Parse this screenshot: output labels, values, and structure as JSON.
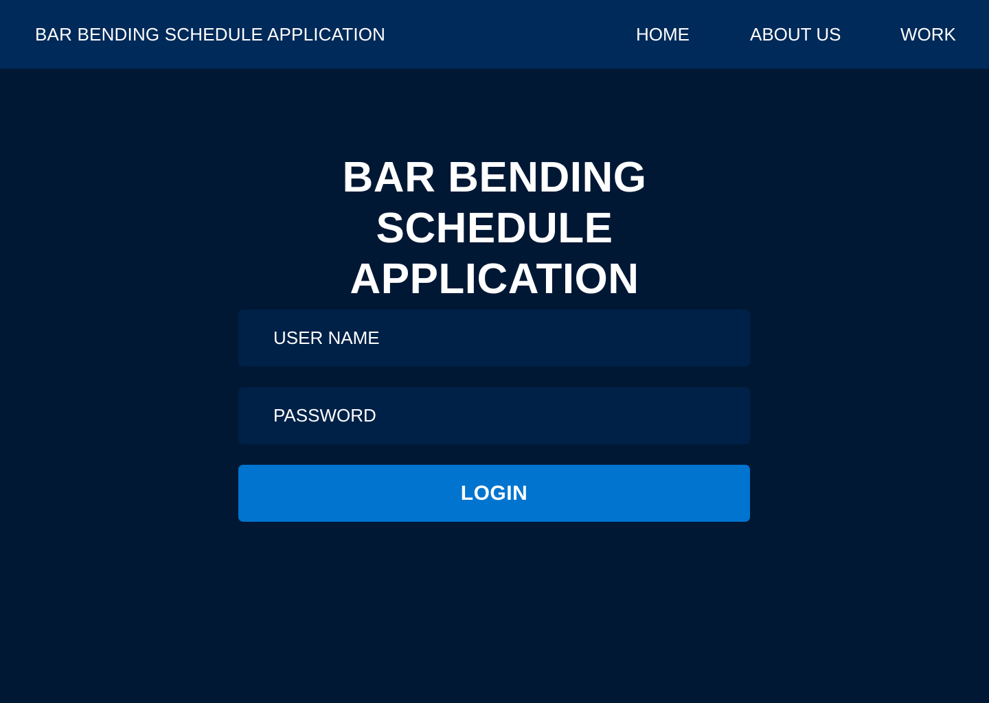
{
  "header": {
    "brand": "BAR BENDING SCHEDULE APPLICATION",
    "nav": {
      "home": "HOME",
      "about": "ABOUT US",
      "work": "WORK"
    }
  },
  "main": {
    "title_line1": "BAR BENDING SCHEDULE",
    "title_line2": "APPLICATION",
    "username": {
      "placeholder": "USER NAME",
      "value": ""
    },
    "password": {
      "placeholder": "PASSWORD",
      "value": ""
    },
    "login_label": "LOGIN"
  },
  "colors": {
    "background": "#011835",
    "navbar": "#002a59",
    "field": "#002147",
    "accent": "#0074cf",
    "text": "#ffffff"
  }
}
